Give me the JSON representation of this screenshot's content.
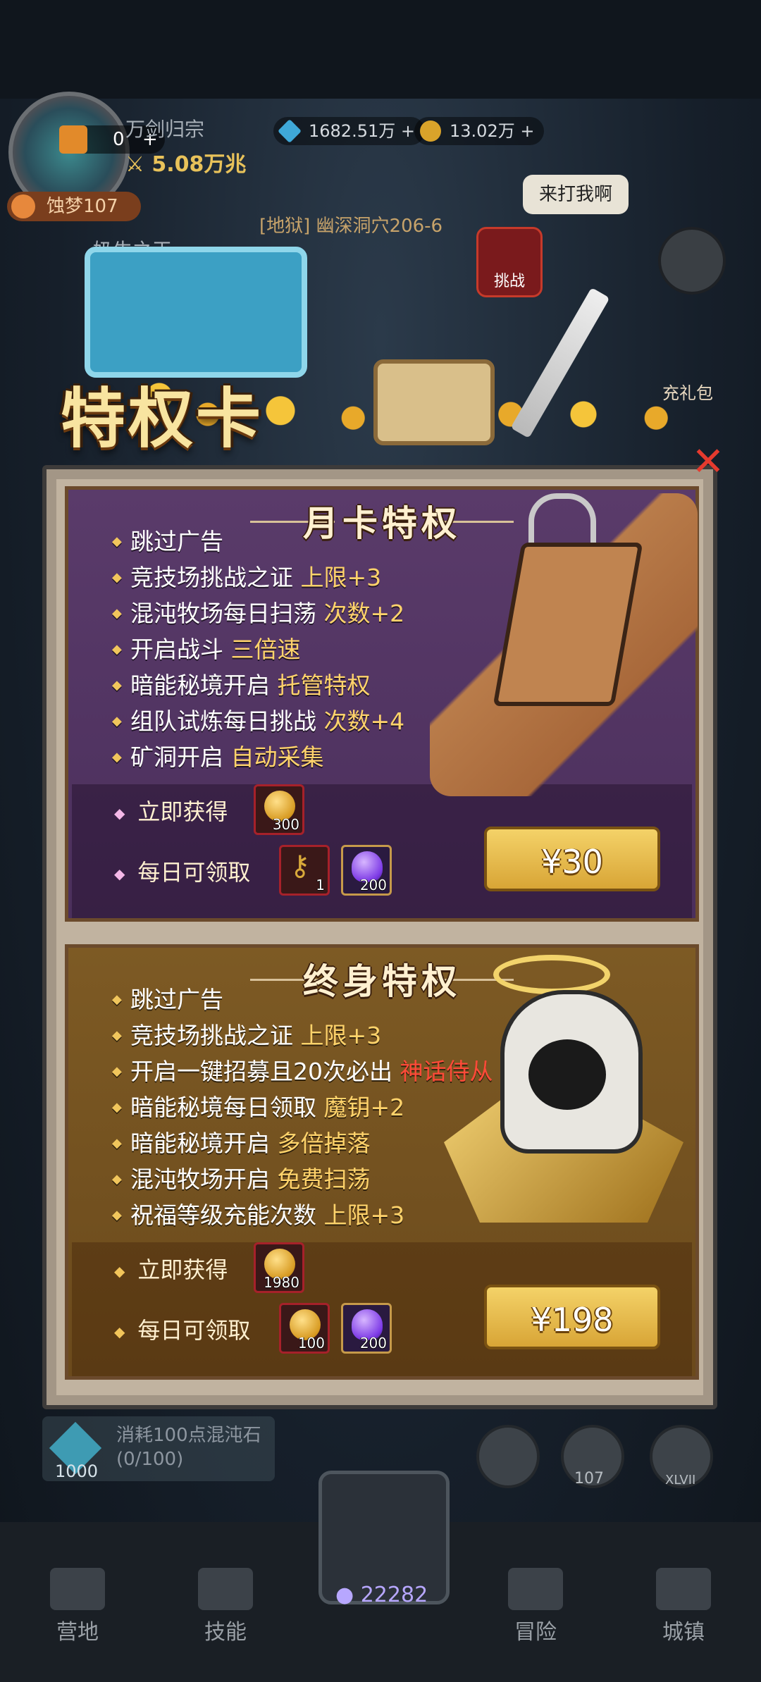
{
  "top_bar": {
    "ticket_count": "0",
    "guild_name": "万剑归宗",
    "power": "5.08万兆",
    "diamonds": "1682.51万",
    "gold": "13.02万",
    "dream_level": "蚀梦107",
    "player_name": "奶牛之王"
  },
  "stage": {
    "label": "[地狱] 幽深洞穴206-6",
    "speech": "来打我啊",
    "challenge": "挑战",
    "recharge_gift": "充礼包"
  },
  "banner": {
    "title": "特权卡"
  },
  "month_card": {
    "title": "月卡特权",
    "perks": [
      {
        "text": "跳过广告",
        "highlight": ""
      },
      {
        "text": "竞技场挑战之证",
        "highlight": "上限+3"
      },
      {
        "text": "混沌牧场每日扫荡",
        "highlight": "次数+2"
      },
      {
        "text": "开启战斗",
        "highlight": "三倍速"
      },
      {
        "text": "暗能秘境开启",
        "highlight": "托管特权"
      },
      {
        "text": "组队试炼每日挑战",
        "highlight": "次数+4"
      },
      {
        "text": "矿洞开启",
        "highlight": "自动采集"
      }
    ],
    "instant_label": "立即获得",
    "daily_label": "每日可领取",
    "instant_items": [
      {
        "icon": "gold-skull-coin-icon",
        "count": "300"
      }
    ],
    "daily_items": [
      {
        "icon": "key-icon",
        "count": "1"
      },
      {
        "icon": "purple-flame-icon",
        "count": "200"
      }
    ],
    "price": "¥30"
  },
  "lifetime_card": {
    "title": "终身特权",
    "perks": [
      {
        "text": "跳过广告",
        "highlight": "",
        "red": ""
      },
      {
        "text": "竞技场挑战之证",
        "highlight": "上限+3",
        "red": ""
      },
      {
        "text": "开启一键招募且20次必出",
        "highlight": "",
        "red": "神话侍从"
      },
      {
        "text": "暗能秘境每日领取",
        "highlight": "魔钥+2",
        "red": ""
      },
      {
        "text": "暗能秘境开启",
        "highlight": "多倍掉落",
        "red": ""
      },
      {
        "text": "混沌牧场开启",
        "highlight": "免费扫荡",
        "red": ""
      },
      {
        "text": "祝福等级充能次数",
        "highlight": "上限+3",
        "red": ""
      }
    ],
    "instant_label": "立即获得",
    "daily_label": "每日可领取",
    "instant_items": [
      {
        "icon": "gold-skull-coin-icon",
        "count": "1980"
      }
    ],
    "daily_items": [
      {
        "icon": "gold-skull-coin-icon",
        "count": "100"
      },
      {
        "icon": "purple-flame-icon",
        "count": "200"
      }
    ],
    "price": "¥198"
  },
  "consume": {
    "text": "消耗100点混沌石",
    "progress": "(0/100)",
    "count": "1000"
  },
  "side_buttons": {
    "gear_level": "107",
    "rank": "XLVII"
  },
  "bottom_nav": {
    "tabs": [
      "营地",
      "技能",
      "冒险",
      "城镇"
    ],
    "center_value": "22282"
  }
}
